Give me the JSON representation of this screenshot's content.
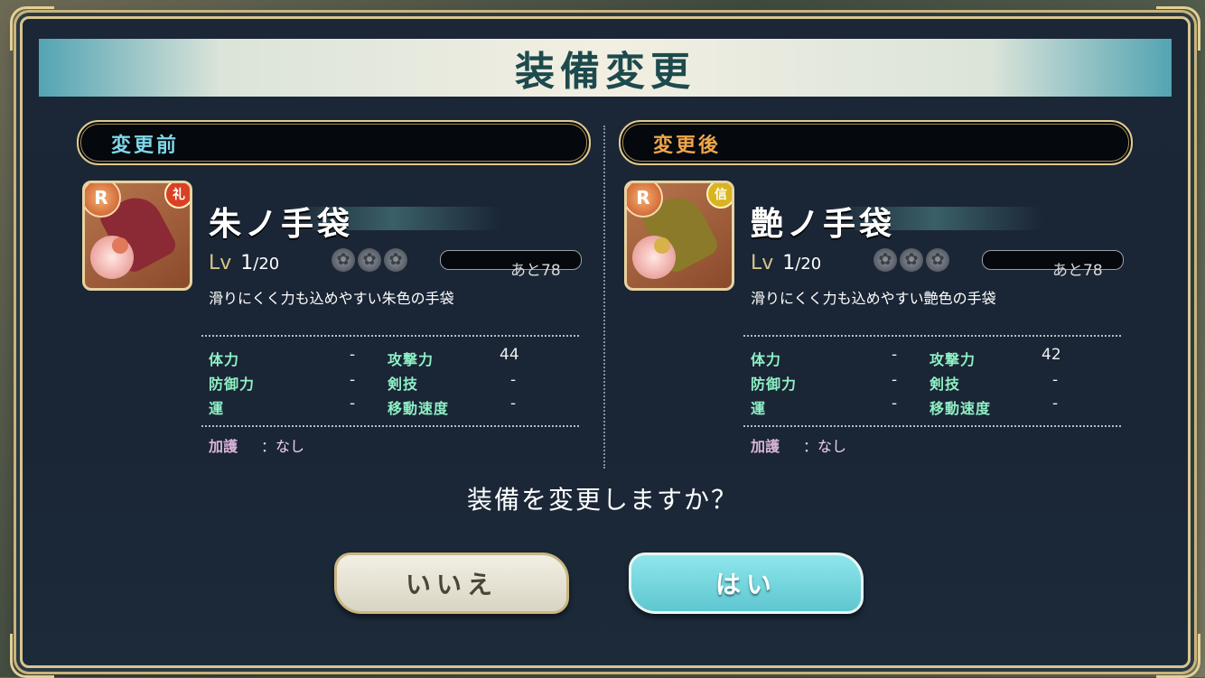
{
  "dialog": {
    "title": "装備変更",
    "question": "装備を変更しますか？",
    "buttons": {
      "no": "いいえ",
      "yes": "はい"
    }
  },
  "before": {
    "header": "変更前",
    "rarity": "R",
    "type_badge": "礼",
    "type_color": "#d94024",
    "glove_color": "#8b2a34",
    "tassel_color": "#e07a5a",
    "name": "朱ノ手袋",
    "lv_label": "Lv",
    "lv": "1",
    "lv_max": "/20",
    "exp_remaining": "あと78",
    "description": "滑りにくく力も込めやすい朱色の手袋",
    "stats": {
      "tairyoku_label": "体力",
      "tairyoku": "-",
      "kougeki_label": "攻撃力",
      "kougeki": "44",
      "bougyo_label": "防御力",
      "bougyo": "-",
      "kengi_label": "剣技",
      "kengi": "-",
      "un_label": "運",
      "un": "-",
      "idou_label": "移動速度",
      "idou": "-"
    },
    "kago_label": "加護",
    "kago": "：なし"
  },
  "after": {
    "header": "変更後",
    "rarity": "R",
    "type_badge": "信",
    "type_color": "#d9b41e",
    "glove_color": "#8a7a2a",
    "tassel_color": "#d9b14a",
    "name": "艶ノ手袋",
    "lv_label": "Lv",
    "lv": "1",
    "lv_max": "/20",
    "exp_remaining": "あと78",
    "description": "滑りにくく力も込めやすい艶色の手袋",
    "stats": {
      "tairyoku_label": "体力",
      "tairyoku": "-",
      "kougeki_label": "攻撃力",
      "kougeki": "42",
      "bougyo_label": "防御力",
      "bougyo": "-",
      "kengi_label": "剣技",
      "kengi": "-",
      "un_label": "運",
      "un": "-",
      "idou_label": "移動速度",
      "idou": "-"
    },
    "kago_label": "加護",
    "kago": "：なし"
  },
  "icons": {
    "gem": "flower-gem-icon",
    "rarity": "rarity-r-icon"
  }
}
